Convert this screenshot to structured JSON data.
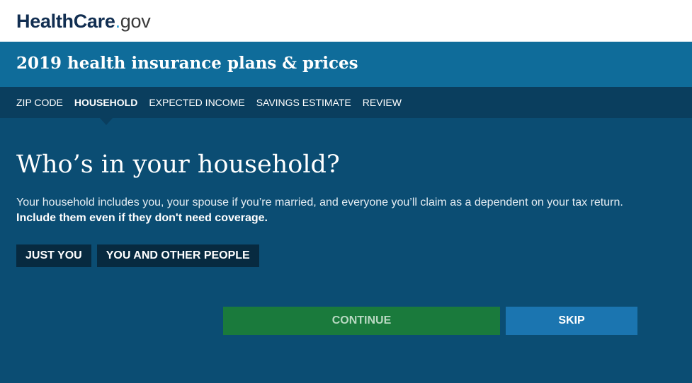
{
  "header": {
    "logo": {
      "health_care": "HealthCare",
      "dot": ".",
      "gov": "gov"
    }
  },
  "titlebar": {
    "title": "2019 health insurance plans & prices"
  },
  "steps": [
    "ZIP CODE",
    "HOUSEHOLD",
    "EXPECTED INCOME",
    "SAVINGS ESTIMATE",
    "REVIEW"
  ],
  "active_step": "HOUSEHOLD",
  "main": {
    "heading": "Who’s in your household?",
    "description": "Your household includes you, your spouse if you’re married, and everyone you’ll claim as a dependent on your tax return.",
    "description_strong": "Include them even if they don't need coverage.",
    "choices": [
      "JUST YOU",
      "YOU AND OTHER PEOPLE"
    ]
  },
  "actions": {
    "continue_label": "CONTINUE",
    "skip_label": "SKIP"
  },
  "colors": {
    "topbar_bg": "#ffffff",
    "titlebar_bg": "#0f6c9a",
    "stepnav_bg": "#0a3e5e",
    "main_bg": "#0b4d73",
    "choice_bg": "#072a40",
    "continue_bg": "#1a7a3c",
    "skip_bg": "#1b75b0"
  }
}
